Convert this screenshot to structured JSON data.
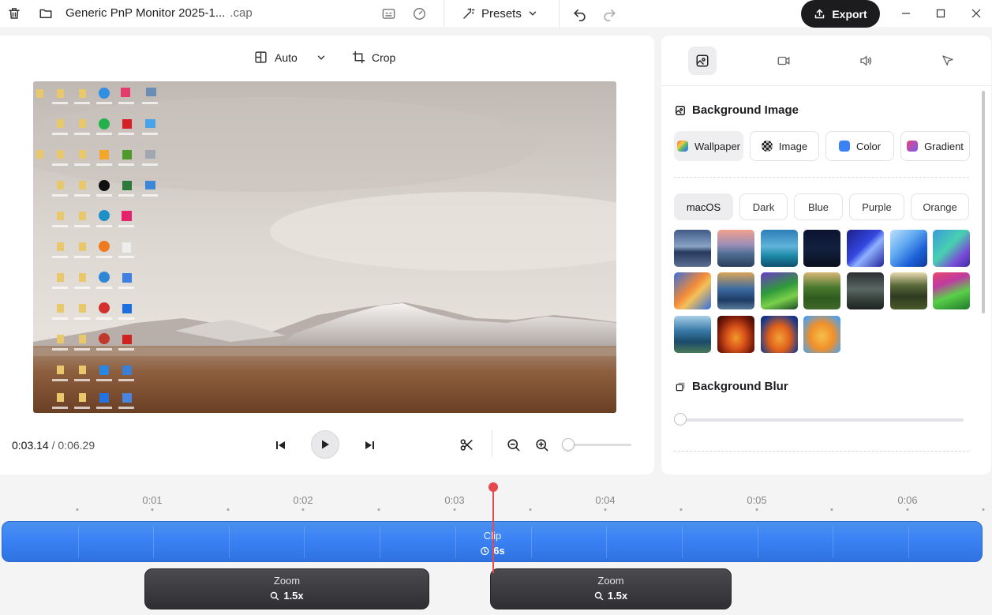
{
  "titlebar": {
    "file_name": "Generic PnP Monitor 2025-1...",
    "file_ext": ".cap",
    "presets_label": "Presets",
    "export_label": "Export"
  },
  "editor": {
    "layout_label": "Auto",
    "crop_label": "Crop",
    "current_time": "0:03.14",
    "time_separator": "/",
    "total_time": "0:06.29",
    "zoom_level": 0.0
  },
  "sidebar": {
    "tabs": [
      "background-tab",
      "camera-tab",
      "audio-tab",
      "cursor-tab"
    ],
    "active_tab": "background-tab",
    "background_image_title": "Background Image",
    "bg_types": [
      {
        "label": "Wallpaper",
        "active": true
      },
      {
        "label": "Image",
        "active": false
      },
      {
        "label": "Color",
        "active": false
      },
      {
        "label": "Gradient",
        "active": false
      }
    ],
    "categories": [
      {
        "label": "macOS",
        "active": true
      },
      {
        "label": "Dark",
        "active": false
      },
      {
        "label": "Blue",
        "active": false
      },
      {
        "label": "Purple",
        "active": false
      },
      {
        "label": "Orange",
        "active": false
      }
    ],
    "wallpaper_count": 18,
    "background_blur_title": "Background Blur",
    "background_blur_value": 0
  },
  "timeline": {
    "ticks": [
      "0:01",
      "0:02",
      "0:03",
      "0:04",
      "0:05",
      "0:06"
    ],
    "clip_label": "Clip",
    "clip_duration": "6s",
    "zoom_segments": [
      {
        "label": "Zoom",
        "value": "1.5x"
      },
      {
        "label": "Zoom",
        "value": "1.5x"
      }
    ],
    "playhead_time": "0:03.14"
  },
  "colors": {
    "accent_blue": "#3b82f6",
    "playhead_red": "#e5484d",
    "export_bg": "#1c1c1f"
  }
}
